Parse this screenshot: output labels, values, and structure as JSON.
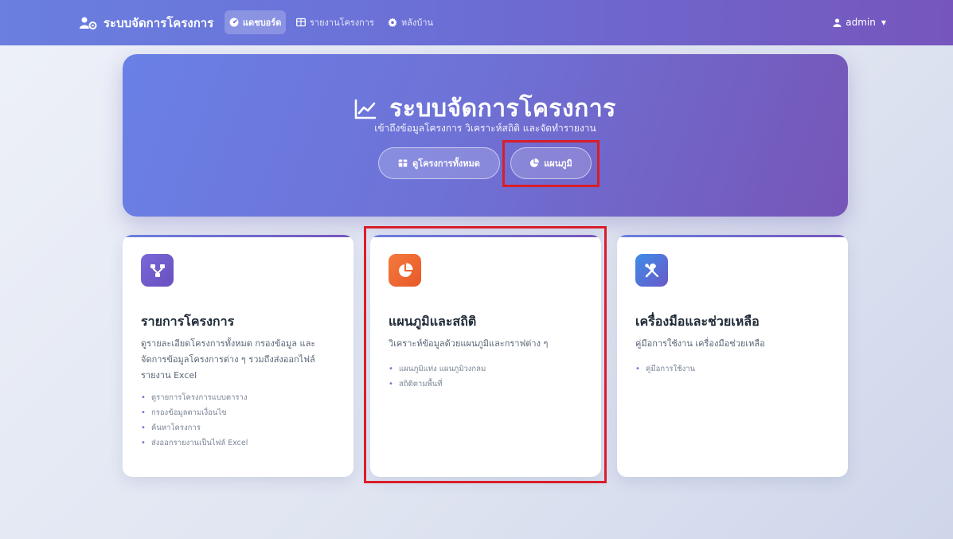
{
  "navbar": {
    "brand": "ระบบจัดการโครงการ",
    "items": [
      {
        "label": "แดชบอร์ด",
        "icon": "dashboard-icon",
        "active": true
      },
      {
        "label": "รายงานโครงการ",
        "icon": "table-icon",
        "active": false
      },
      {
        "label": "หลังบ้าน",
        "icon": "gear-icon",
        "active": false
      }
    ],
    "user": "admin"
  },
  "hero": {
    "title": "ระบบจัดการโครงการ",
    "subtitle": "เข้าถึงข้อมูลโครงการ วิเคราะห์สถิติ และจัดทำรายงาน",
    "buttons": [
      {
        "label": "ดูโครงการทั้งหมด",
        "icon": "table-icon"
      },
      {
        "label": "แผนภูมิ",
        "icon": "pie-chart-icon"
      }
    ]
  },
  "cards": [
    {
      "title": "รายการโครงการ",
      "icon": "project-tree-icon",
      "description": "ดูรายละเอียดโครงการทั้งหมด กรองข้อมูล และจัดการข้อมูลโครงการต่าง ๆ รวมถึงส่งออกไฟล์รายงาน Excel",
      "items": [
        "ดูรายการโครงการแบบตาราง",
        "กรองข้อมูลตามเงื่อนไข",
        "ค้นหาโครงการ",
        "ส่งออกรายงานเป็นไฟล์ Excel"
      ]
    },
    {
      "title": "แผนภูมิและสถิติ",
      "icon": "pie-chart-icon",
      "description": "วิเคราะห์ข้อมูลด้วยแผนภูมิและกราฟต่าง ๆ",
      "items": [
        "แผนภูมิแท่ง แผนภูมิวงกลม",
        "สถิติตามพื้นที่"
      ]
    },
    {
      "title": "เครื่องมือและช่วยเหลือ",
      "icon": "tools-icon",
      "description": "คู่มือการใช้งาน เครื่องมือช่วยเหลือ",
      "items": [
        "คู่มือการใช้งาน"
      ]
    }
  ],
  "colors": {
    "navbar_start": "#6a7fe0",
    "navbar_end": "#7656bc",
    "highlight": "#d91e2a",
    "orange_icon": "#f47a3c"
  }
}
